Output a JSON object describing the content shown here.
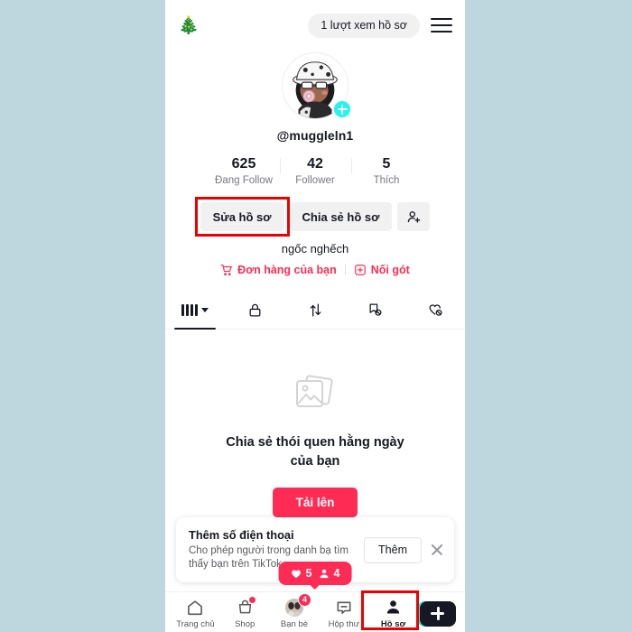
{
  "topbar": {
    "tree_emoji": "🎄",
    "views_pill": "1 lượt xem hồ sơ",
    "menu_icon": "hamburger-icon"
  },
  "profile": {
    "handle": "@muggleln1",
    "avatar_badge_icon": "plus-icon",
    "bio": "ngốc nghếch",
    "stats": [
      {
        "value": "625",
        "label": "Đang Follow"
      },
      {
        "value": "42",
        "label": "Follower"
      },
      {
        "value": "5",
        "label": "Thích"
      }
    ],
    "actions": {
      "edit_label": "Sửa hồ sơ",
      "share_label": "Chia sẻ hồ sơ",
      "add_friend_icon": "person-add-icon"
    },
    "bio_links": [
      {
        "label": "Đơn hàng của bạn",
        "icon": "shopping-cart-icon"
      },
      {
        "label": "Nối gót",
        "icon": "add-box-icon"
      }
    ]
  },
  "tabs": [
    {
      "name": "videos",
      "icon": "grid-bars-icon",
      "active": true
    },
    {
      "name": "private",
      "icon": "lock-icon",
      "active": false
    },
    {
      "name": "reposts",
      "icon": "repost-arrows-icon",
      "active": false
    },
    {
      "name": "saved",
      "icon": "bookmark-hidden-icon",
      "active": false
    },
    {
      "name": "liked",
      "icon": "heart-hidden-icon",
      "active": false
    }
  ],
  "empty_state": {
    "icon": "photo-stack-icon",
    "text": "Chia sẻ thói quen hằng ngày của bạn",
    "button_label": "Tải lên"
  },
  "banner": {
    "title": "Thêm số điện thoại",
    "subtitle": "Cho phép người trong danh bạ tìm thấy bạn trên TikTok",
    "button_label": "Thêm",
    "close_icon": "close-icon"
  },
  "float_pill": {
    "likes_icon": "heart-icon",
    "likes": "5",
    "friends_icon": "person-icon",
    "friends": "4"
  },
  "bottom_nav": [
    {
      "label": "Trang chủ",
      "icon": "home-icon",
      "badge": "",
      "active": false
    },
    {
      "label": "Shop",
      "icon": "shopping-bag-icon",
      "badge": "dot",
      "active": false
    },
    {
      "label": "Bạn bè",
      "icon": "friends-avatar-icon",
      "badge": "4",
      "active": false
    },
    {
      "label": "Hộp thư",
      "icon": "message-icon",
      "badge": "",
      "active": false
    },
    {
      "label": "Hồ sơ",
      "icon": "person-icon",
      "badge": "",
      "active": true
    }
  ],
  "create_button": {
    "icon": "tiktok-plus-icon"
  },
  "colors": {
    "brand_red": "#fe2c55",
    "brand_cyan": "#25f4ee",
    "highlight_red": "#ee0000",
    "page_background": "#bed6de",
    "text_primary": "#161823",
    "text_secondary": "#78787f"
  }
}
